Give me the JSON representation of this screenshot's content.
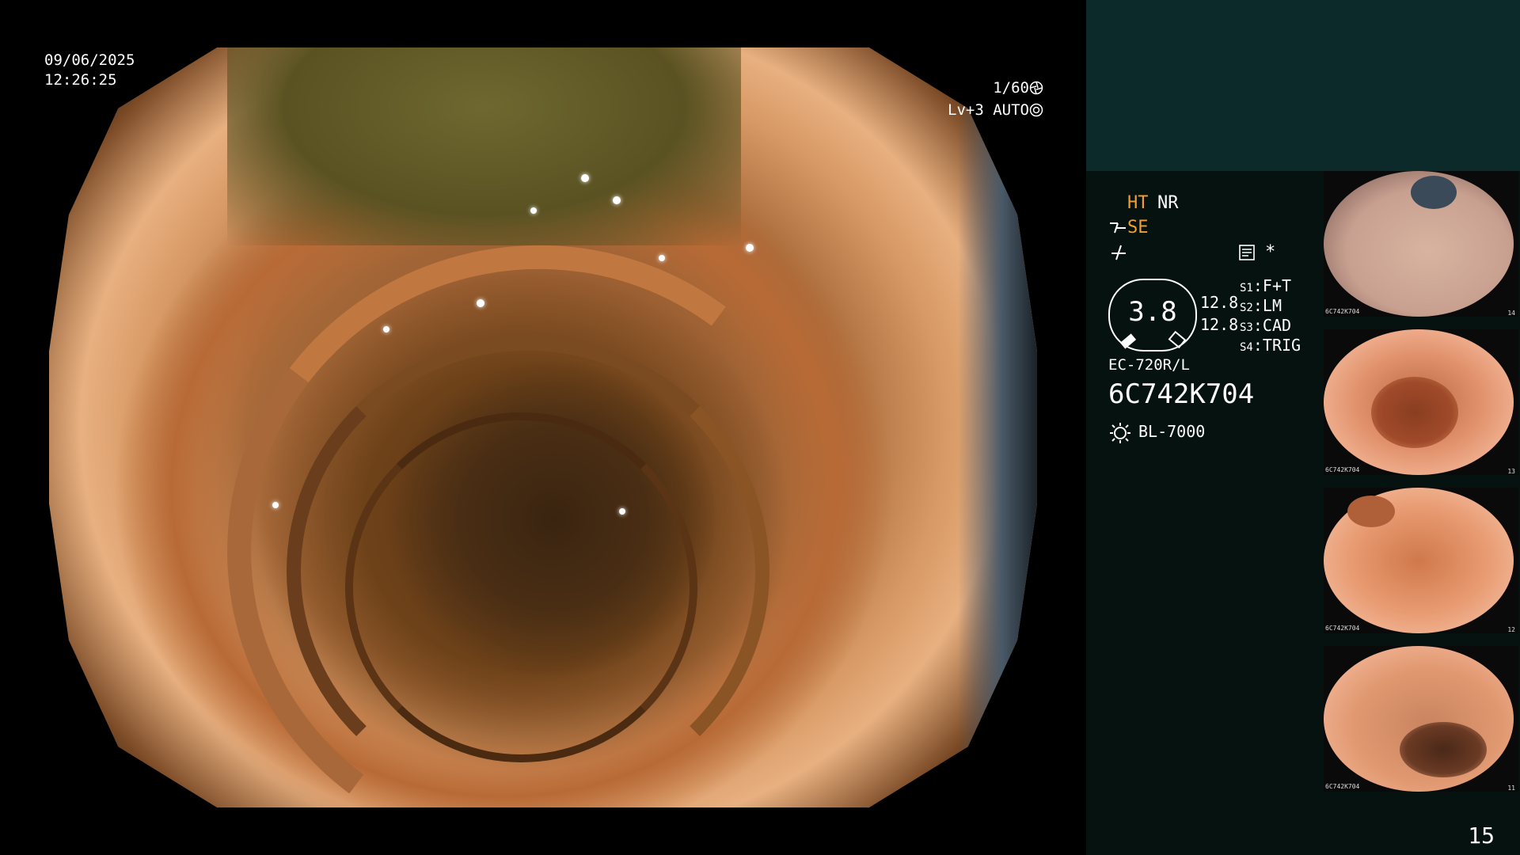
{
  "osd": {
    "date": "09/06/2025",
    "time": "12:26:25",
    "shutter": "1/60",
    "level": "Lv+3 AUTO"
  },
  "sidebar": {
    "ht": "HT",
    "nr": "NR",
    "se": "SE",
    "asterisk": "*",
    "gauge_value": "3.8",
    "gauge_side_1": "12.8",
    "gauge_side_2": "12.8",
    "switches": [
      {
        "key": "S1",
        "value": "F+T"
      },
      {
        "key": "S2",
        "value": "LM"
      },
      {
        "key": "S3",
        "value": "CAD"
      },
      {
        "key": "S4",
        "value": "TRIG"
      }
    ],
    "scope_model": "EC-720R/L",
    "serial": "6C742K704",
    "light_source": "BL-7000"
  },
  "thumbnails": [
    {
      "caption": "6C742K704",
      "number": "14",
      "tone": "#c8a090",
      "hole": "#3a4a58"
    },
    {
      "caption": "6C742K704",
      "number": "13",
      "tone": "#e0906a",
      "hole": "#a04a2a"
    },
    {
      "caption": "6C742K704",
      "number": "12",
      "tone": "#e89a70",
      "hole": "#b06038"
    },
    {
      "caption": "6C742K704",
      "number": "11",
      "tone": "#e09870",
      "hole": "#6a3a24"
    }
  ],
  "page_number": "15",
  "colors": {
    "accent_orange": "#f0a030",
    "sidebar_bg": "#06120f",
    "sidebar_top_bg": "#0d2a2a"
  },
  "icons": [
    "shutter-icon",
    "auto-iris-icon",
    "scope-tip-icon",
    "sharpen-icon",
    "memo-icon",
    "lamp-icon"
  ]
}
